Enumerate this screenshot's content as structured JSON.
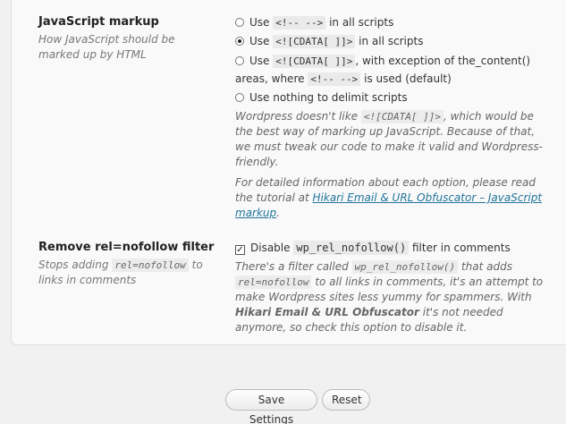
{
  "js_section": {
    "title": "JavaScript markup",
    "description": "How JavaScript should be marked up by HTML",
    "options": [
      {
        "pre": "Use",
        "code": "<!-- -->",
        "post": "in all scripts",
        "selected": false
      },
      {
        "pre": "Use",
        "code": "<![CDATA[ ]]>",
        "post": "in all scripts",
        "selected": true
      },
      {
        "pre": "Use",
        "code": "<![CDATA[ ]]>",
        "post": ", with exception of the_content()",
        "line2_pre": "areas, where",
        "line2_code": "<!-- -->",
        "line2_post": "is used (default)",
        "selected": false
      },
      {
        "pre": "Use nothing to delimit scripts",
        "selected": false
      }
    ],
    "help1_a": "Wordpress doesn't like",
    "help1_code": "<![CDATA[ ]]>",
    "help1_b": ", which would be the best way of marking up JavaScript. Because of that, we must tweak our code to make it valid and Wordpress-friendly.",
    "help2_a": "For detailed information about each option, please read the tutorial at",
    "help2_link": "Hikari Email & URL Obfuscator – JavaScript markup",
    "help2_b": "."
  },
  "nofollow_section": {
    "title": "Remove rel=nofollow filter",
    "desc_a": "Stops adding",
    "desc_code": "rel=nofollow",
    "desc_b": "to links in comments",
    "checkbox": {
      "pre": "Disable",
      "code": "wp_rel_nofollow()",
      "post": "filter in comments",
      "checked": true
    },
    "help_a": "There's a filter called",
    "help_code1": "wp_rel_nofollow()",
    "help_b": "that adds",
    "help_code2": "rel=nofollow",
    "help_c": "to all links in comments, it's an attempt to make Wordpress sites less yummy for spammers. With",
    "help_strong": "Hikari Email & URL Obfuscator",
    "help_d": "it's not needed anymore, so check this option to disable it."
  },
  "buttons": {
    "save": "Save Settings",
    "reset": "Reset"
  }
}
